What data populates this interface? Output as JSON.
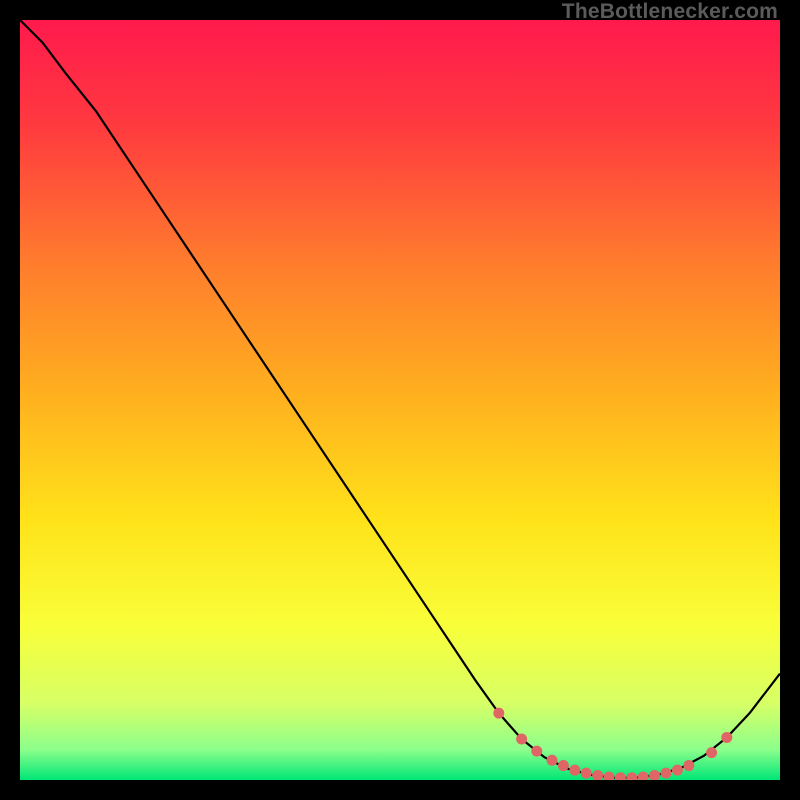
{
  "watermark": "TheBottlenecker.com",
  "chart_data": {
    "type": "line",
    "title": "",
    "xlabel": "",
    "ylabel": "",
    "xlim": [
      0,
      100
    ],
    "ylim": [
      0,
      100
    ],
    "series": [
      {
        "name": "curve",
        "color": "#000000",
        "x": [
          0,
          3,
          6,
          10,
          15,
          20,
          25,
          30,
          35,
          40,
          45,
          50,
          55,
          60,
          63,
          66,
          69,
          72,
          75,
          78,
          81,
          84,
          87,
          90,
          93,
          96,
          100
        ],
        "y": [
          100,
          97,
          93,
          88,
          80.5,
          73,
          65.5,
          58,
          50.5,
          43,
          35.5,
          28,
          20.5,
          13,
          8.8,
          5.4,
          3.0,
          1.5,
          0.7,
          0.3,
          0.3,
          0.7,
          1.6,
          3.2,
          5.6,
          8.8,
          14
        ]
      }
    ],
    "markers": {
      "name": "dots",
      "color": "#e06666",
      "x": [
        63,
        66,
        68,
        70,
        71.5,
        73,
        74.5,
        76,
        77.5,
        79,
        80.5,
        82,
        83.5,
        85,
        86.5,
        88,
        91,
        93
      ],
      "y": [
        8.8,
        5.4,
        3.8,
        2.6,
        1.9,
        1.3,
        0.9,
        0.6,
        0.4,
        0.3,
        0.3,
        0.4,
        0.6,
        0.9,
        1.3,
        1.9,
        3.6,
        5.6
      ]
    },
    "gradient_stops": [
      {
        "offset": 0.0,
        "color": "#ff1a4d"
      },
      {
        "offset": 0.14,
        "color": "#ff3a3f"
      },
      {
        "offset": 0.32,
        "color": "#ff7c2d"
      },
      {
        "offset": 0.5,
        "color": "#ffb21e"
      },
      {
        "offset": 0.66,
        "color": "#ffe31a"
      },
      {
        "offset": 0.8,
        "color": "#f8ff3a"
      },
      {
        "offset": 0.9,
        "color": "#d6ff66"
      },
      {
        "offset": 0.96,
        "color": "#8cff8c"
      },
      {
        "offset": 1.0,
        "color": "#00e676"
      }
    ]
  }
}
